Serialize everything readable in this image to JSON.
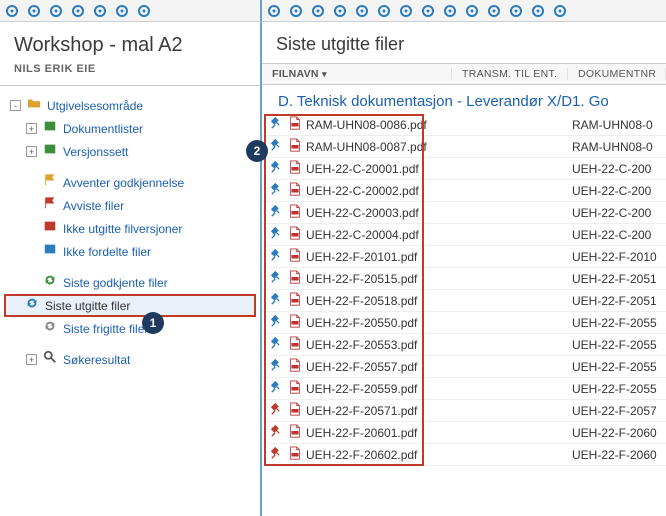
{
  "toolbar_left_count": 7,
  "toolbar_right_count": 14,
  "left": {
    "title": "Workshop - mal A2",
    "user": "NILS ERIK EIE",
    "tree": [
      {
        "label": "Utgivelsesområde",
        "indent": 0,
        "icon": "folder-open",
        "expander": "-"
      },
      {
        "label": "Dokumentlister",
        "indent": 1,
        "icon": "doclist",
        "expander": "+"
      },
      {
        "label": "Versjonssett",
        "indent": 1,
        "icon": "version",
        "expander": "+"
      },
      {
        "label": "Avventer godkjennelse",
        "indent": 1,
        "icon": "flag-yellow",
        "expander": ""
      },
      {
        "label": "Avviste filer",
        "indent": 1,
        "icon": "flag-red",
        "expander": ""
      },
      {
        "label": "Ikke utgitte filversjoner",
        "indent": 1,
        "icon": "box-red",
        "expander": ""
      },
      {
        "label": "Ikke fordelte filer",
        "indent": 1,
        "icon": "box-blue",
        "expander": ""
      },
      {
        "label": "Siste godkjente filer",
        "indent": 1,
        "icon": "refresh-green",
        "expander": ""
      },
      {
        "label": "Siste utgitte filer",
        "indent": 1,
        "icon": "refresh-blue",
        "expander": "",
        "selected": true
      },
      {
        "label": "Siste frigitte filer",
        "indent": 1,
        "icon": "refresh-gray",
        "expander": ""
      },
      {
        "label": "Søkeresultat",
        "indent": 1,
        "icon": "search",
        "expander": "+"
      }
    ]
  },
  "right": {
    "header": "Siste utgitte filer",
    "columns": {
      "filnavn": "FILNAVN",
      "transm": "TRANSM. TIL ENT.",
      "dok": "DOKUMENTNR"
    },
    "sort_indicator": "▾",
    "breadcrumb": "D. Teknisk dokumentasjon - Leverandør X/D1. Go",
    "files": [
      {
        "name": "RAM-UHN08-0086.pdf",
        "doc": "RAM-UHN08-0",
        "pin": "blue"
      },
      {
        "name": "RAM-UHN08-0087.pdf",
        "doc": "RAM-UHN08-0",
        "pin": "blue"
      },
      {
        "name": "UEH-22-C-20001.pdf",
        "doc": "UEH-22-C-200",
        "pin": "blue"
      },
      {
        "name": "UEH-22-C-20002.pdf",
        "doc": "UEH-22-C-200",
        "pin": "blue"
      },
      {
        "name": "UEH-22-C-20003.pdf",
        "doc": "UEH-22-C-200",
        "pin": "blue"
      },
      {
        "name": "UEH-22-C-20004.pdf",
        "doc": "UEH-22-C-200",
        "pin": "blue"
      },
      {
        "name": "UEH-22-F-20101.pdf",
        "doc": "UEH-22-F-2010",
        "pin": "blue"
      },
      {
        "name": "UEH-22-F-20515.pdf",
        "doc": "UEH-22-F-2051",
        "pin": "blue"
      },
      {
        "name": "UEH-22-F-20518.pdf",
        "doc": "UEH-22-F-2051",
        "pin": "blue"
      },
      {
        "name": "UEH-22-F-20550.pdf",
        "doc": "UEH-22-F-2055",
        "pin": "blue"
      },
      {
        "name": "UEH-22-F-20553.pdf",
        "doc": "UEH-22-F-2055",
        "pin": "blue"
      },
      {
        "name": "UEH-22-F-20557.pdf",
        "doc": "UEH-22-F-2055",
        "pin": "blue"
      },
      {
        "name": "UEH-22-F-20559.pdf",
        "doc": "UEH-22-F-2055",
        "pin": "blue"
      },
      {
        "name": "UEH-22-F-20571.pdf",
        "doc": "UEH-22-F-2057",
        "pin": "red"
      },
      {
        "name": "UEH-22-F-20601.pdf",
        "doc": "UEH-22-F-2060",
        "pin": "red"
      },
      {
        "name": "UEH-22-F-20602.pdf",
        "doc": "UEH-22-F-2060",
        "pin": "red"
      }
    ]
  },
  "callouts": {
    "one": "1",
    "two": "2"
  }
}
